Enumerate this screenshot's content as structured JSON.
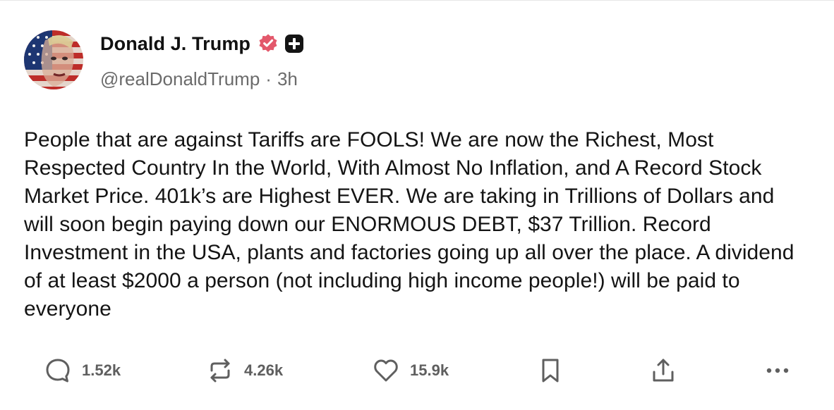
{
  "author": {
    "display_name": "Donald J. Trump",
    "handle": "@realDonaldTrump",
    "separator": "·",
    "time_ago": "3h",
    "verified_color": "#e3586b",
    "avatar_icon": "flag-portrait-avatar"
  },
  "post": {
    "text": "People that are against Tariffs are FOOLS! We are now the Richest, Most Respected Country In the World, With Almost No Inflation, and A Record Stock Market Price. 401k’s are Highest EVER. We are taking in Trillions of Dollars and will soon begin paying down our ENORMOUS DEBT, $37 Trillion. Record Investment in the USA, plants and factories going up all over the place. A dividend of at least $2000 a person (not including high income people!) will be paid to everyone"
  },
  "actions": {
    "reply_count": "1.52k",
    "repost_count": "4.26k",
    "like_count": "15.9k",
    "icons": [
      "reply-icon",
      "repost-icon",
      "like-icon",
      "bookmark-icon",
      "share-icon",
      "more-icon"
    ]
  },
  "colors": {
    "text": "#141414",
    "muted": "#6b6b6b",
    "icon": "#5f5f5f",
    "badge": "#e3586b"
  }
}
